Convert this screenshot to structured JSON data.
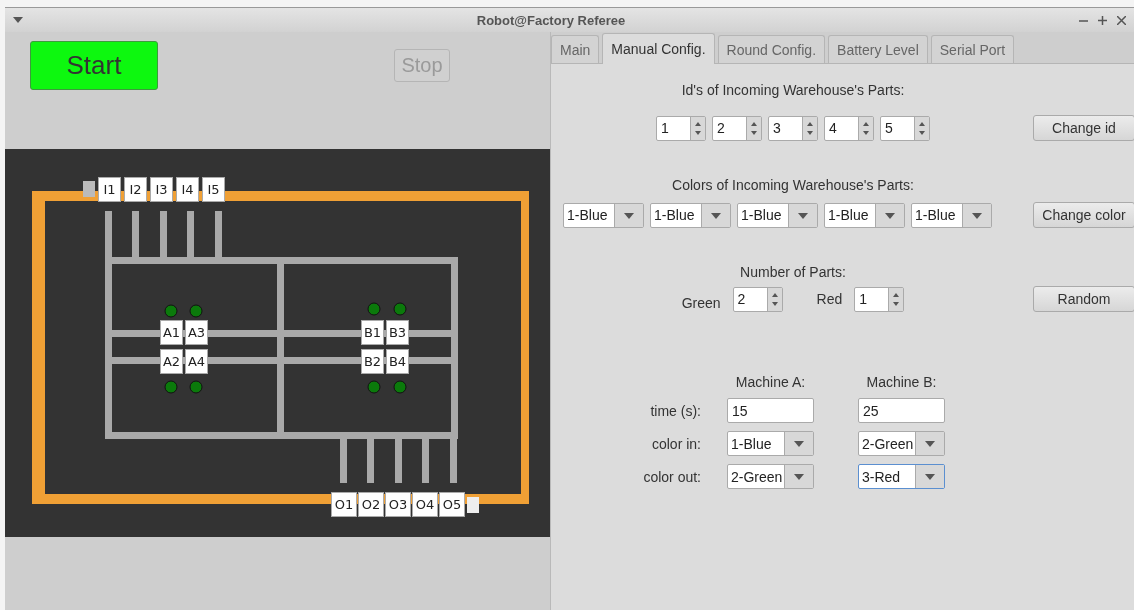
{
  "window": {
    "title": "Robot@Factory Referee"
  },
  "controls": {
    "start": {
      "label": "Start",
      "disabled": false
    },
    "stop": {
      "label": "Stop",
      "disabled": true
    }
  },
  "map": {
    "input_stations": [
      "I1",
      "I2",
      "I3",
      "I4",
      "I5"
    ],
    "machines": [
      {
        "top": [
          "A1",
          "A3"
        ],
        "bottom": [
          "A2",
          "A4"
        ]
      },
      {
        "top": [
          "B1",
          "B3"
        ],
        "bottom": [
          "B2",
          "B4"
        ]
      }
    ],
    "output_stations": [
      "O1",
      "O2",
      "O3",
      "O4",
      "O5"
    ]
  },
  "tabs": [
    {
      "label": "Main",
      "selected": false
    },
    {
      "label": "Manual Config.",
      "selected": true
    },
    {
      "label": "Round Config.",
      "selected": false
    },
    {
      "label": "Battery Level",
      "selected": false
    },
    {
      "label": "Serial Port",
      "selected": false
    }
  ],
  "manual_config": {
    "ids_heading": "Id's of Incoming Warehouse's Parts:",
    "ids": [
      "1",
      "2",
      "3",
      "4",
      "5"
    ],
    "change_id": "Change id",
    "colors_heading": "Colors of Incoming Warehouse's Parts:",
    "colors": [
      "1-Blue",
      "1-Blue",
      "1-Blue",
      "1-Blue",
      "1-Blue"
    ],
    "change_color": "Change color",
    "parts_heading": "Number of Parts:",
    "parts": [
      {
        "label": "Green",
        "value": "2"
      },
      {
        "label": "Red",
        "value": "1"
      }
    ],
    "random": "Random",
    "machine_headers": [
      "Machine A:",
      "Machine B:"
    ],
    "machine_rows": [
      {
        "label": "time (s):",
        "kind": "text",
        "values": [
          {
            "value": "15",
            "focused": false
          },
          {
            "value": "25",
            "focused": false
          }
        ]
      },
      {
        "label": "color in:",
        "kind": "combo",
        "values": [
          {
            "value": "1-Blue",
            "focused": false
          },
          {
            "value": "2-Green",
            "focused": false
          }
        ]
      },
      {
        "label": "color out:",
        "kind": "combo",
        "values": [
          {
            "value": "2-Green",
            "focused": false
          },
          {
            "value": "3-Red",
            "focused": true
          }
        ]
      }
    ]
  }
}
